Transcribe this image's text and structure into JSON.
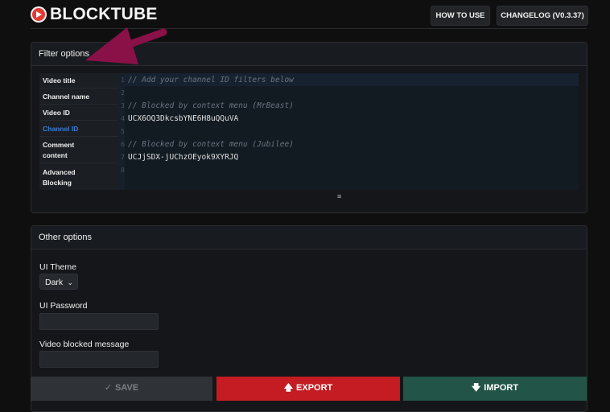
{
  "header": {
    "brand": "BLOCKTUBE",
    "how_to_use": "HOW TO USE",
    "changelog": "CHANGELOG (V0.3.37)"
  },
  "filter_panel": {
    "title": "Filter options",
    "sidebar": [
      {
        "label": "Video title",
        "active": false
      },
      {
        "label": "Channel name",
        "active": false
      },
      {
        "label": "Video ID",
        "active": false
      },
      {
        "label": "Channel ID",
        "active": true
      },
      {
        "label": "Comment content",
        "active": false
      },
      {
        "label": "Advanced Blocking",
        "active": false
      }
    ],
    "line_numbers": [
      "1",
      "2",
      "3",
      "4",
      "5",
      "6",
      "7",
      "8"
    ],
    "lines": [
      "// Add your channel ID filters below",
      "",
      "// Blocked by context menu (MrBeast)",
      "UCX6OQ3DkcsbYNE6H8uQQuVA",
      "",
      "// Blocked by context menu (Jubilee)",
      "UCJjSDX-jUChzOEyok9XYRJQ",
      ""
    ],
    "resize_handle": "≡"
  },
  "other_panel": {
    "title": "Other options",
    "ui_theme_label": "UI Theme",
    "ui_theme_value": "Dark",
    "ui_password_label": "UI Password",
    "ui_password_value": "",
    "video_blocked_label": "Video blocked message",
    "video_blocked_value": ""
  },
  "footer": {
    "save": "SAVE",
    "save_icon": "✓",
    "export": "EXPORT",
    "export_icon": "🡅",
    "import": "IMPORT",
    "import_icon": "🡇"
  },
  "colors": {
    "accent_active": "#3b7dd8",
    "export_red": "#c41c22",
    "import_green": "#225448",
    "annotation_arrow": "#8a1048"
  }
}
